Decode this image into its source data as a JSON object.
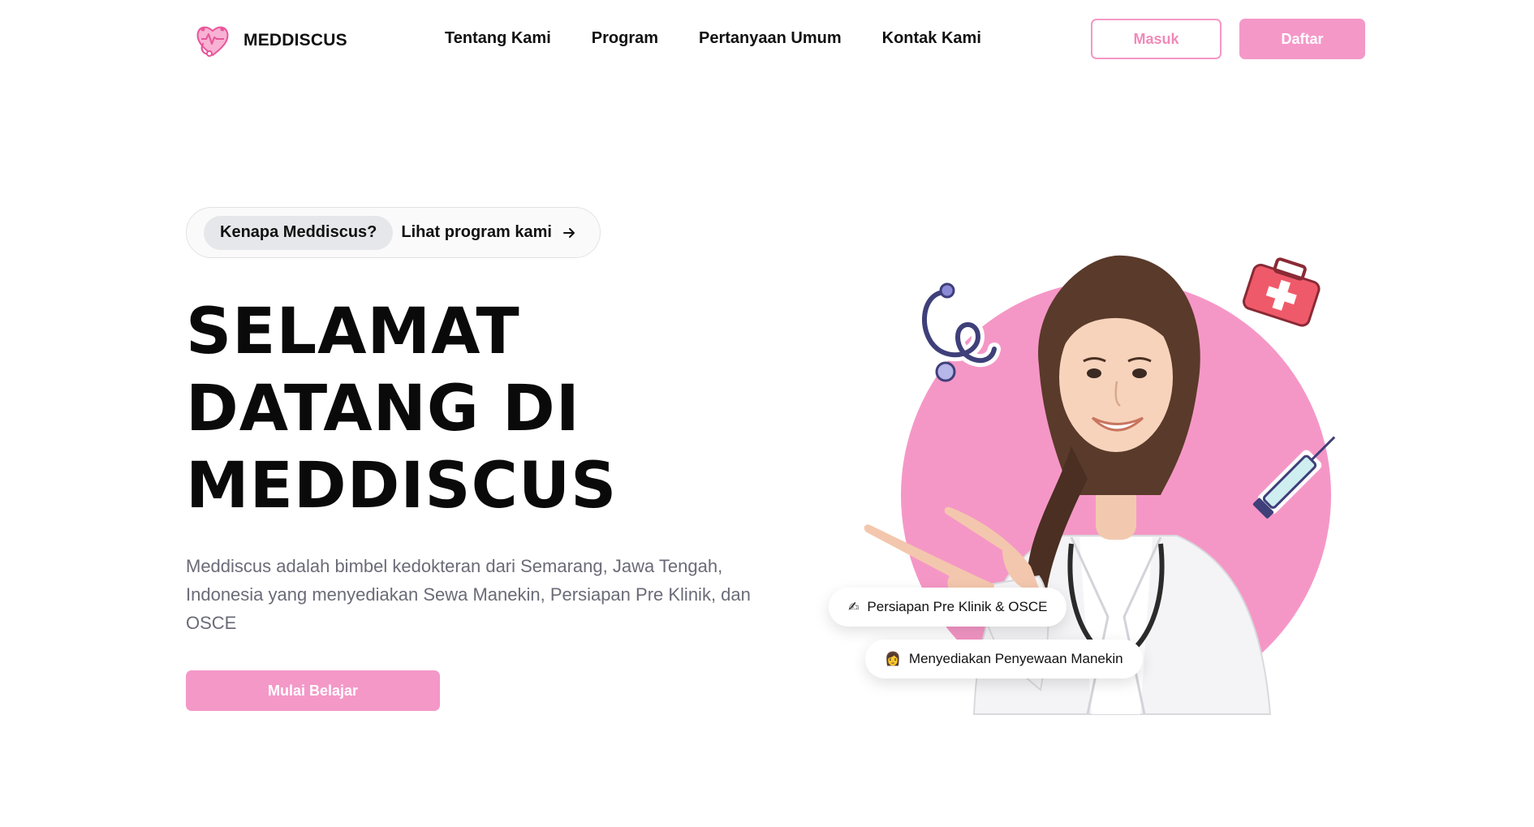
{
  "nav": {
    "brand": "MEDDISCUS",
    "links": [
      "Tentang Kami",
      "Program",
      "Pertanyaan Umum",
      "Kontak Kami"
    ],
    "login_label": "Masuk",
    "register_label": "Daftar"
  },
  "hero": {
    "pill_tag": "Kenapa Meddiscus?",
    "pill_link": "Lihat program kami",
    "title_lines": [
      "SELAMAT",
      "DATANG DI",
      "MEDDISCUS"
    ],
    "description": "Meddiscus adalah bimbel kedokteran dari Semarang, Jawa Tengah, Indonesia yang menyediakan Sewa Manekin, Persiapan Pre Klinik, dan OSCE",
    "cta_label": "Mulai Belajar",
    "badges": [
      {
        "icon": "writing-hand-icon",
        "label": "Persiapan Pre Klinik & OSCE"
      },
      {
        "icon": "doctor-icon",
        "label": "Menyediakan Penyewaan Manekin"
      }
    ]
  },
  "colors": {
    "accent_pink": "#f498c8",
    "circle_pink": "#f597c6",
    "text_dark": "#111111",
    "text_muted": "#6b6b78"
  }
}
